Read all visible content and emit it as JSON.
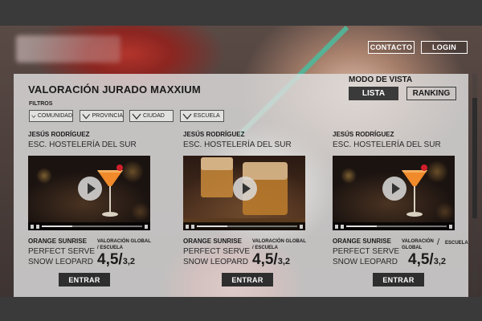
{
  "header": {
    "contact_label": "CONTACTO",
    "login_label": "LOGIN"
  },
  "main": {
    "title": "VALORACIÓN JURADO MAXXIUM",
    "view_mode": {
      "label": "MODO DE VISTA",
      "options": [
        "LISTA",
        "RANKING"
      ],
      "selected": "LISTA"
    },
    "filters": {
      "label": "FILTROS",
      "items": [
        "COMUNIDAD",
        "PROVINCIA",
        "CIUDAD",
        "ESCUELA"
      ]
    },
    "cards": [
      {
        "judge": "JESÚS RODRÍGUEZ",
        "school": "ESC. HOSTELERÍA DEL SUR",
        "drinks": [
          "ORANGE SUNRISE",
          "PERFECT SERVE",
          "SNOW LEOPARD"
        ],
        "rating_label": "VALORACIÓN GLOBAL / ESCUELA",
        "rating_global": "4,5/",
        "rating_school": "3,2",
        "enter_label": "ENTRAR"
      },
      {
        "judge": "JESÚS RODRÍGUEZ",
        "school": "ESC. HOSTELERÍA DEL SUR",
        "drinks": [
          "ORANGE SUNRISE",
          "PERFECT SERVE",
          "SNOW LEOPARD"
        ],
        "rating_label": "VALORACIÓN GLOBAL / ESCUELA",
        "rating_global": "4,5/",
        "rating_school": "3,2",
        "enter_label": "ENTRAR"
      },
      {
        "judge": "JESÚS RODRÍGUEZ",
        "school": "ESC. HOSTELERÍA DEL SUR",
        "drinks": [
          "ORANGE SUNRISE",
          "PERFECT SERVE",
          "SNOW LEOPARD"
        ],
        "rating_label": "VALORACIÓN GLOBAL",
        "rating_label_2": "ESCUELA",
        "rating_slash": "/",
        "rating_global": "4,5/",
        "rating_school": "3,2",
        "enter_label": "ENTRAR"
      }
    ]
  },
  "colors": {
    "panel_bg": "#dedede",
    "dark": "#2e2e2e",
    "accent_straw": "#4fb89a"
  }
}
